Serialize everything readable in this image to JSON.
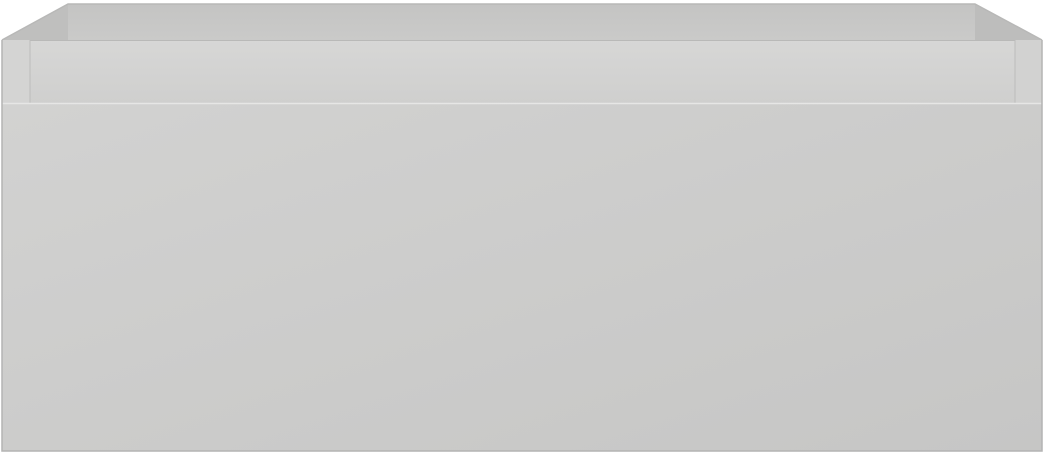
{
  "image": {
    "subject": "drawer-front-product-render",
    "colors": {
      "background": "#ffffff",
      "front": "#cbcbca",
      "front_highlight": "#d2d2d1",
      "top_rail": "#d0d0cf",
      "inner_back": "#c7c7c6",
      "inner_wall": "#bdbdbc",
      "edge_light": "#e4e4e3",
      "edge_dark": "#b3b3b2"
    }
  }
}
